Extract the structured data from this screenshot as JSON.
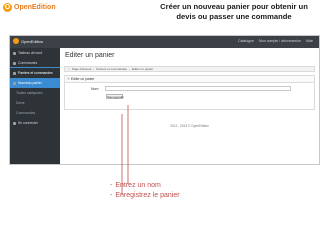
{
  "brand": {
    "name": "OpenEdition",
    "logo_letter": "O"
  },
  "slide": {
    "title_line1": "Créer un nouveau panier pour obtenir un",
    "title_line2": "devis ou passer une commande"
  },
  "app": {
    "logo_text": "OpenEdition",
    "top_links": [
      "Catalogue",
      "Mon compte / déconnexion",
      "Aide"
    ],
    "sidebar": {
      "items": [
        {
          "label": "Tableau de bord"
        },
        {
          "label": "Commandes"
        },
        {
          "label": "Paniers et commandes"
        },
        {
          "label": "Nouveau panier"
        },
        {
          "label": "Toutes catégories"
        },
        {
          "label": "Devis"
        },
        {
          "label": "Commandes"
        },
        {
          "label": "Se connecter"
        }
      ]
    },
    "page_title": "Editer un panier",
    "breadcrumb": [
      "Page d'accueil",
      "Paniers et commandes",
      "Editer un panier"
    ],
    "tab_label": "Editer un panier",
    "form": {
      "name_label": "Nom",
      "name_value": "",
      "submit_label": "Sauvegarder"
    },
    "footer": "2012 - 2013 © OpenEdition"
  },
  "notes": [
    {
      "dash": "-",
      "text": "Entrez un nom"
    },
    {
      "dash": "-",
      "text": "Enregistrez le panier"
    }
  ],
  "colors": {
    "brand_orange": "#e67e22",
    "note_red": "#c0504d",
    "sidebar_bg": "#2e3338",
    "highlight_blue": "#3a8bd1"
  }
}
